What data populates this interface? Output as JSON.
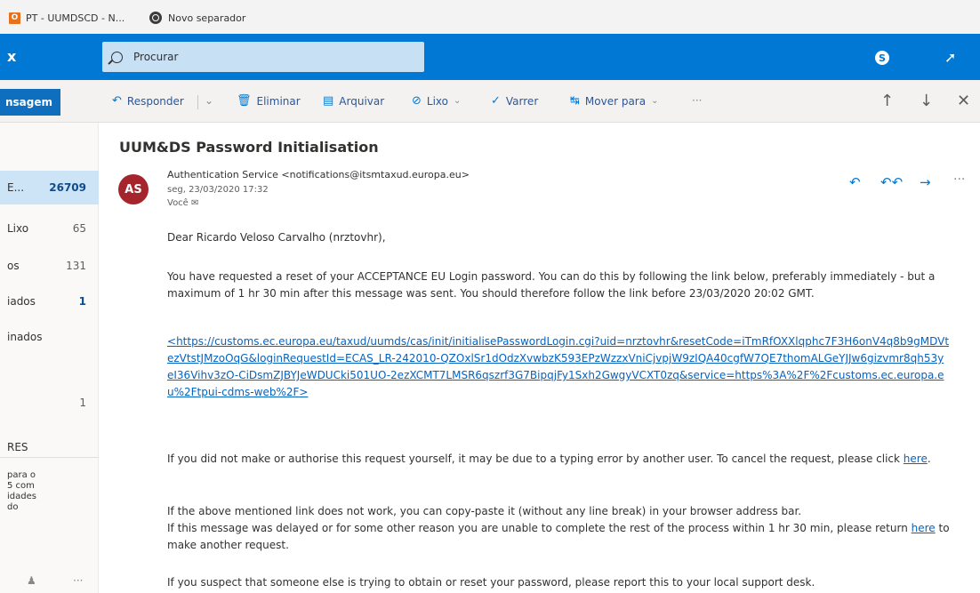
{
  "browser": {
    "tabs": [
      {
        "label": "PT - UUMDSCD - N..."
      },
      {
        "label": "Novo separador"
      }
    ]
  },
  "header": {
    "left_label": "x",
    "search_placeholder": "Procurar",
    "skype_label": "S"
  },
  "toolbar": {
    "new_message_label": "nsagem",
    "reply_label": "Responder",
    "delete_label": "Eliminar",
    "archive_label": "Arquivar",
    "junk_label": "Lixo",
    "sweep_label": "Varrer",
    "move_label": "Mover para",
    "more_label": "···"
  },
  "folders": [
    {
      "label": "E...",
      "count": "26709",
      "active": true
    },
    {
      "label": "Lixo",
      "count": "65"
    },
    {
      "label": "os",
      "count": "131"
    },
    {
      "label": "iados",
      "count": "1"
    },
    {
      "label": "inados",
      "count": ""
    },
    {
      "label": "",
      "count": "1"
    },
    {
      "label": "RES",
      "count": ""
    }
  ],
  "promo_text": "para o\n5 com\nidades\ndo",
  "left_footer": {
    "people_icon": "people-icon",
    "more": "···"
  },
  "message": {
    "subject": "UUM&DS Password Initialisation",
    "avatar_initials": "AS",
    "sender": "Authentication Service <notifications@itsmtaxud.europa.eu>",
    "date": "seg, 23/03/2020 17:32",
    "to": "Você ✉",
    "greeting": "Dear Ricardo Veloso Carvalho (nrztovhr),",
    "paragraph1": "You have requested a reset of your ACCEPTANCE EU Login password. You can do this by following the link below, preferably immediately - but a maximum of 1 hr 30 min after this message was sent. You should therefore follow the link before 23/03/2020 20:02 GMT.",
    "url_prefix": "<",
    "url": "https://customs.ec.europa.eu/taxud/uumds/cas/init/initialisePasswordLogin.cgi?uid=nrztovhr&resetCode=iTmRfOXXlqphc7F3H6onV4q8b9gMDVtezVtstJMzoOqG&loginRequestId=ECAS_LR-242010-QZOxlSr1dOdzXvwbzK593EPzWzzxVniCjvpjW9zIQA40cgfW7QE7thomALGeYJJw6gizvmr8qh53yeI36Vihv3zO-CiDsmZJBYJeWDUCki501UO-2ezXCMT7LMSR6qszrf3G7BipqjFy1Sxh2GwgyVCXT0zq&service=https%3A%2F%2Fcustoms.ec.europa.eu%2Ftpui-cdms-web%2F>",
    "paragraph2_before": "If you did not make or authorise this request yourself, it may be due to a typing error by another user. To cancel the request, please click ",
    "paragraph2_link": "here",
    "paragraph2_after": ".",
    "paragraph3_line1": "If the above mentioned link does not work, you can copy-paste it (without any line break) in your browser address bar.",
    "paragraph3_line2_before": "If this message was delayed or for some other reason you are unable to complete the rest of the process within 1 hr 30 min, please return ",
    "paragraph3_link": "here",
    "paragraph3_after": " to make another request.",
    "paragraph4": "If you suspect that someone else is trying to obtain or reset your password, please report this to your local support desk."
  },
  "colors": {
    "accent": "#0078d4",
    "avatar": "#a4262c",
    "selected_folder": "#cde3f6",
    "link": "#0563c1"
  }
}
